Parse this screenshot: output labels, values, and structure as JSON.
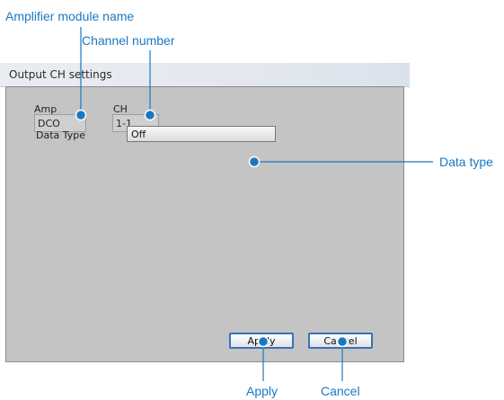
{
  "callouts": {
    "amplifier_module_name": "Amplifier module name",
    "channel_number": "Channel number",
    "data_type": "Data type",
    "apply": "Apply",
    "cancel": "Cancel"
  },
  "dialog": {
    "title": "Output CH settings",
    "amp_label": "Amp",
    "amp_value": "DCO",
    "ch_label": "CH",
    "ch_value": "1-1",
    "data_type_label": "Data Type",
    "data_type_value": "Off",
    "apply_label": "Apply",
    "cancel_label": "Cancel"
  },
  "colors": {
    "callout": "#1a78c2",
    "dialog_bg": "#c4c4c4",
    "button_border": "#3b6fb8"
  }
}
